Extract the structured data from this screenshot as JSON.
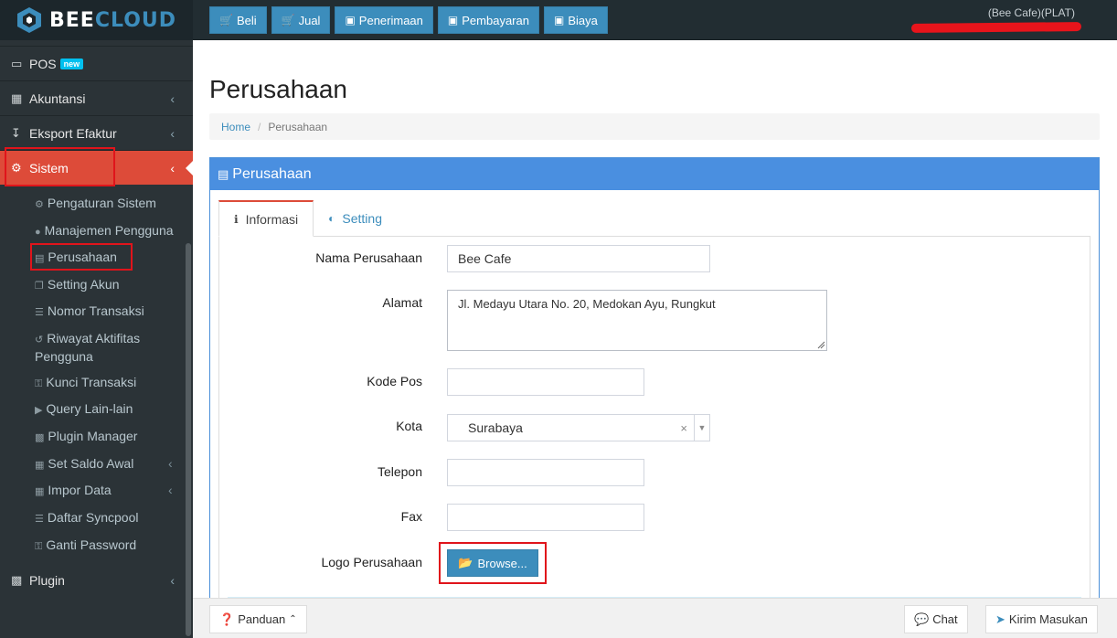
{
  "brand": {
    "part1": "BEE",
    "part2": "CLOUD"
  },
  "topnav": [
    {
      "icon": "cart-icon",
      "glyph": "🛒",
      "label": "Beli"
    },
    {
      "icon": "cart-icon",
      "glyph": "🛒",
      "label": "Jual"
    },
    {
      "icon": "money-icon",
      "glyph": "💵",
      "label": "Penerimaan"
    },
    {
      "icon": "money-icon",
      "glyph": "💵",
      "label": "Pembayaran"
    },
    {
      "icon": "money-icon",
      "glyph": "💵",
      "label": "Biaya"
    }
  ],
  "user": {
    "company": "(Bee Cafe)(PLAT)"
  },
  "sidebar": {
    "items": [
      {
        "label": "POS",
        "badge": "new",
        "icon": "monitor-icon"
      },
      {
        "label": "Akuntansi",
        "icon": "bar-chart-icon"
      },
      {
        "label": "Eksport Efaktur",
        "icon": "export-icon"
      },
      {
        "label": "Sistem",
        "icon": "gears-icon"
      },
      {
        "label": "Plugin",
        "icon": "puzzle-icon"
      }
    ],
    "sub": [
      {
        "label": "Pengaturan Sistem",
        "icon": "gear-icon"
      },
      {
        "label": "Manajemen Pengguna",
        "icon": "users-icon"
      },
      {
        "label": "Perusahaan",
        "icon": "clipboard-icon"
      },
      {
        "label": "Setting Akun",
        "icon": "copy-icon"
      },
      {
        "label": "Nomor Transaksi",
        "icon": "list-icon"
      },
      {
        "label": "Riwayat Aktifitas Pengguna",
        "icon": "history-icon"
      },
      {
        "label": "Kunci Transaksi",
        "icon": "key-icon"
      },
      {
        "label": "Query Lain-lain",
        "icon": "play-icon"
      },
      {
        "label": "Plugin Manager",
        "icon": "puzzle-icon"
      },
      {
        "label": "Set Saldo Awal",
        "icon": "calculator-icon"
      },
      {
        "label": "Impor Data",
        "icon": "table-icon"
      },
      {
        "label": "Daftar Syncpool",
        "icon": "list-icon"
      },
      {
        "label": "Ganti Password",
        "icon": "key-icon"
      }
    ]
  },
  "page": {
    "title": "Perusahaan",
    "breadcrumb": {
      "home": "Home",
      "current": "Perusahaan"
    },
    "panel_title": "Perusahaan",
    "tabs": [
      {
        "label": "Informasi",
        "icon": "info-icon"
      },
      {
        "label": "Setting",
        "icon": "contrast-icon"
      }
    ]
  },
  "form": {
    "nama": {
      "label": "Nama Perusahaan",
      "value": "Bee Cafe"
    },
    "alamat": {
      "label": "Alamat",
      "value": "Jl. Medayu Utara No. 20, Medokan Ayu, Rungkut"
    },
    "kodepos": {
      "label": "Kode Pos",
      "value": ""
    },
    "kota": {
      "label": "Kota",
      "value": "Surabaya"
    },
    "telepon": {
      "label": "Telepon",
      "value": ""
    },
    "fax": {
      "label": "Fax",
      "value": ""
    },
    "logo": {
      "label": "Logo Perusahaan",
      "button": "Browse..."
    }
  },
  "footer": {
    "panduan": "Panduan",
    "chat": "Chat",
    "kirim": "Kirim Masukan"
  },
  "colors": {
    "accent": "#3c8dbc",
    "active": "#dd4b39",
    "highlight": "#e0141b"
  }
}
